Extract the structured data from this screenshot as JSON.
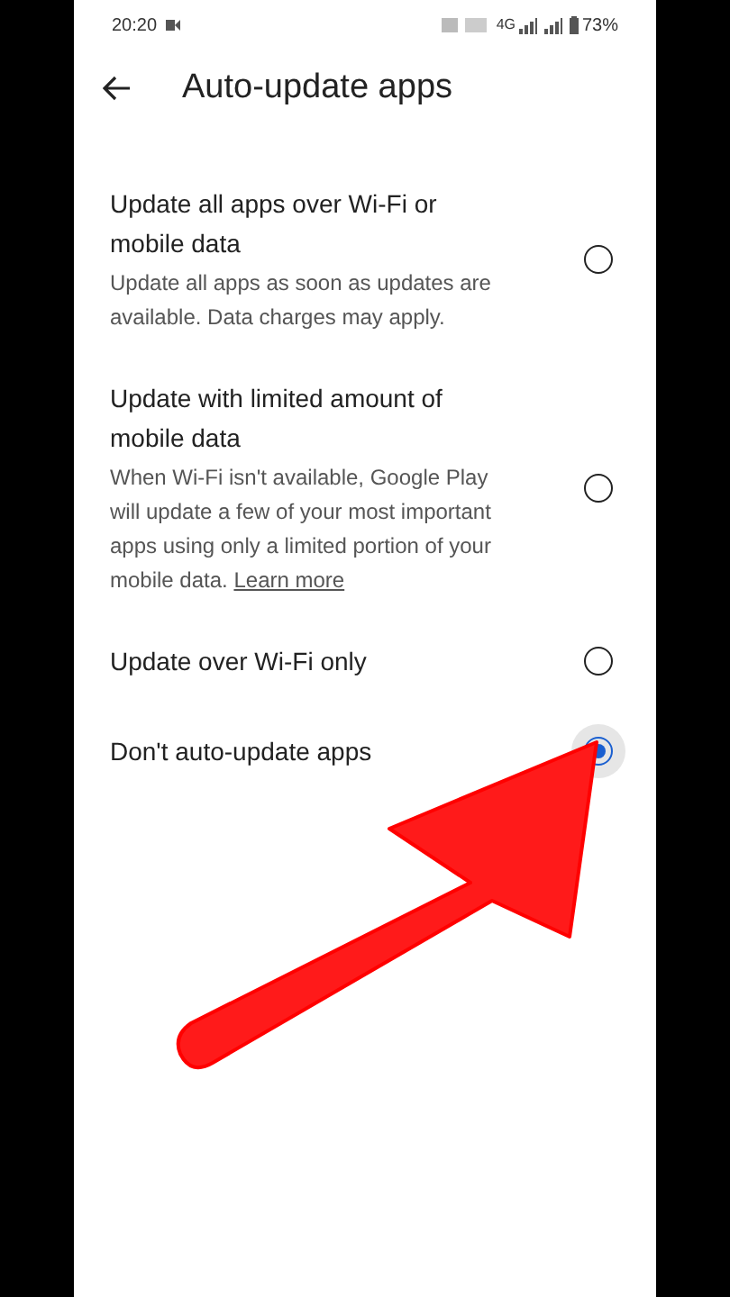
{
  "status_bar": {
    "time": "20:20",
    "network": "4G",
    "battery": "73%"
  },
  "header": {
    "title": "Auto-update apps"
  },
  "options": [
    {
      "title": "Update all apps over Wi-Fi or mobile data",
      "description": "Update all apps as soon as updates are available. Data charges may apply.",
      "selected": false
    },
    {
      "title": "Update with limited amount of mobile data",
      "description": "When Wi-Fi isn't available, Google Play will update a few of your most important apps using only a limited portion of your mobile data.",
      "link": "Learn more",
      "selected": false
    },
    {
      "title": "Update over Wi-Fi only",
      "selected": false
    },
    {
      "title": "Don't auto-update apps",
      "selected": true
    }
  ]
}
